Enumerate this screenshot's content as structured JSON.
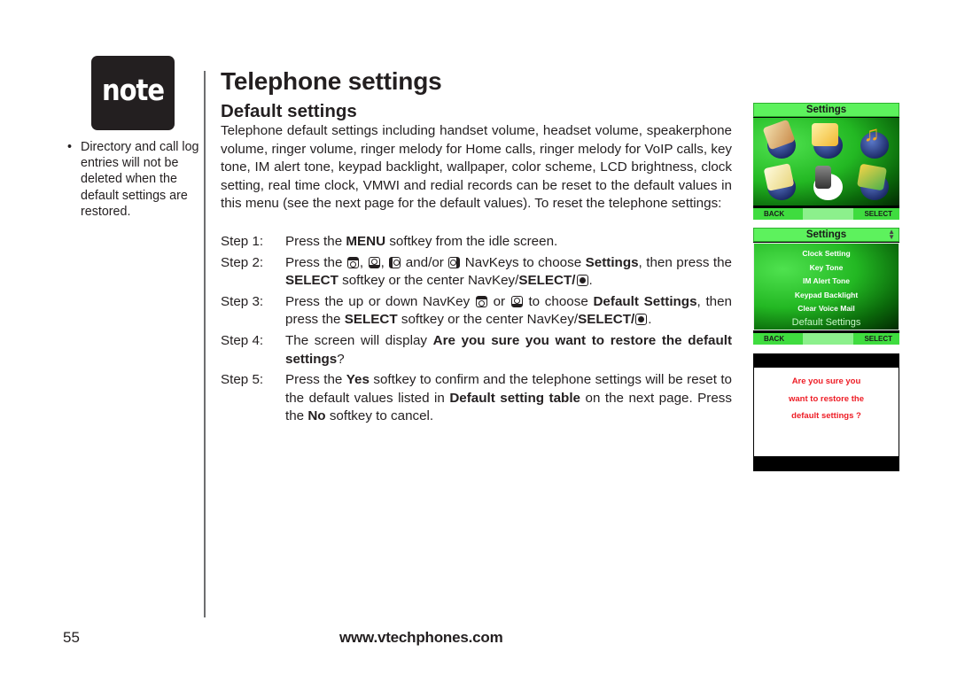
{
  "sidebar": {
    "note_label": "note",
    "notes": [
      "Directory and call log entries will not be deleted when the default settings are restored."
    ]
  },
  "header": {
    "title": "Telephone settings",
    "section_title": "Default settings"
  },
  "intro": "Telephone default settings including handset volume, headset volume, speakerphone volume, ringer volume, ringer melody for Home calls, ringer melody for VoIP calls, key tone, IM alert tone, keypad backlight, wallpaper, color scheme, LCD brightness, clock setting, real time clock, VMWI and redial records can be reset to the default values in this menu (see the next page for the default values). To reset the telephone settings:",
  "steps": [
    {
      "label": "Step 1:",
      "parts": [
        "Press the ",
        "MENU",
        " softkey from the idle screen."
      ]
    },
    {
      "label": "Step 2:",
      "parts": [
        "Press the ",
        ", ",
        ", ",
        " and/or ",
        " NavKeys to choose ",
        "Settings",
        ", then press the ",
        "SELECT",
        " softkey or the center NavKey/",
        "SELECT/",
        "."
      ]
    },
    {
      "label": "Step 3:",
      "parts": [
        "Press the up or down NavKey ",
        " or ",
        " to choose ",
        "Default Settings",
        ", then press the ",
        "SELECT",
        " softkey or the center NavKey/",
        "SELECT/",
        "."
      ]
    },
    {
      "label": "Step 4:",
      "parts": [
        "The screen will display ",
        "Are you sure you want to restore the default settings",
        "?"
      ]
    },
    {
      "label": "Step 5:",
      "parts": [
        "Press the ",
        "Yes",
        " softkey to confirm and the telephone settings will be reset to the default values listed in ",
        "Default setting table",
        " on the next page. Press the ",
        "No",
        " softkey to cancel."
      ]
    }
  ],
  "screens": {
    "main_menu": {
      "title": "Settings",
      "icons": [
        "directory-icon",
        "messages-icon",
        "music-icon",
        "notes-icon",
        "phone-settings-icon",
        "pictures-icon"
      ],
      "left_softkey": "BACK",
      "right_softkey": "SELECT"
    },
    "settings_menu": {
      "title": "Settings",
      "items": [
        "Clock Setting",
        "Key Tone",
        "IM Alert Tone",
        "Keypad Backlight",
        "Clear Voice Mail"
      ],
      "selected_item": "Default Settings",
      "left_softkey": "BACK",
      "right_softkey": "SELECT"
    },
    "confirm": {
      "lines": [
        "Are you sure you",
        "want to restore the",
        "default settings ?"
      ]
    }
  },
  "colors": {
    "screen_green": "#3fdc3f",
    "dialog_text": "#ee1c25"
  },
  "footer": {
    "page_number": "55",
    "website": "www.vtechphones.com"
  }
}
